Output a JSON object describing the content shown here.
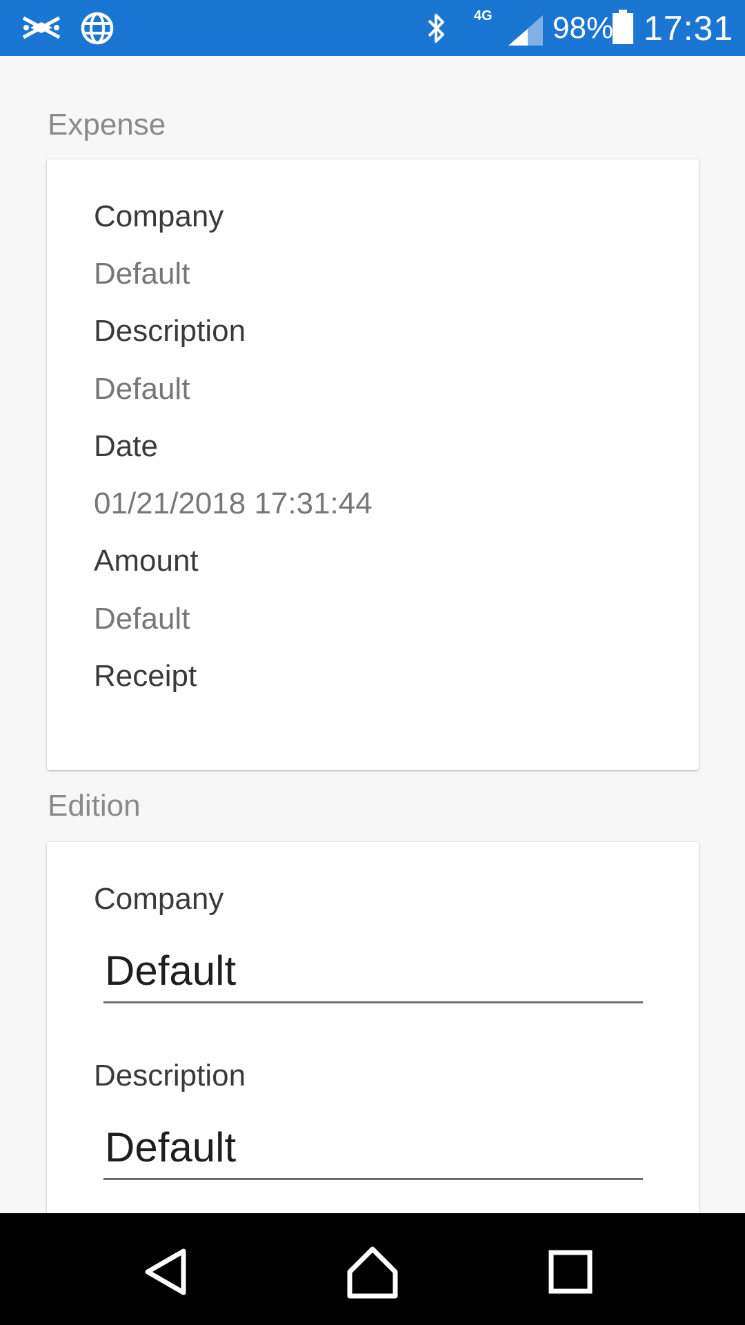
{
  "status_bar": {
    "network": "4G",
    "battery": "98%",
    "time": "17:31",
    "icons": [
      "crossed-network-icon",
      "globe-icon",
      "bluetooth-icon",
      "signal-icon",
      "battery-icon"
    ]
  },
  "expense": {
    "section_title": "Expense",
    "fields": [
      {
        "label": "Company",
        "value": "Default"
      },
      {
        "label": "Description",
        "value": "Default"
      },
      {
        "label": "Date",
        "value": "01/21/2018 17:31:44"
      },
      {
        "label": "Amount",
        "value": "Default"
      },
      {
        "label": "Receipt",
        "value": ""
      }
    ]
  },
  "edition": {
    "section_title": "Edition",
    "company_label": "Company",
    "company_value": "Default",
    "description_label": "Description",
    "description_value": "Default"
  },
  "nav_bar": {
    "icons": [
      "back-icon",
      "home-icon",
      "recents-icon"
    ]
  },
  "colors": {
    "status_bar": "#1a76d2",
    "background": "#f7f7f7",
    "card": "#ffffff",
    "nav_bar": "#000000"
  }
}
